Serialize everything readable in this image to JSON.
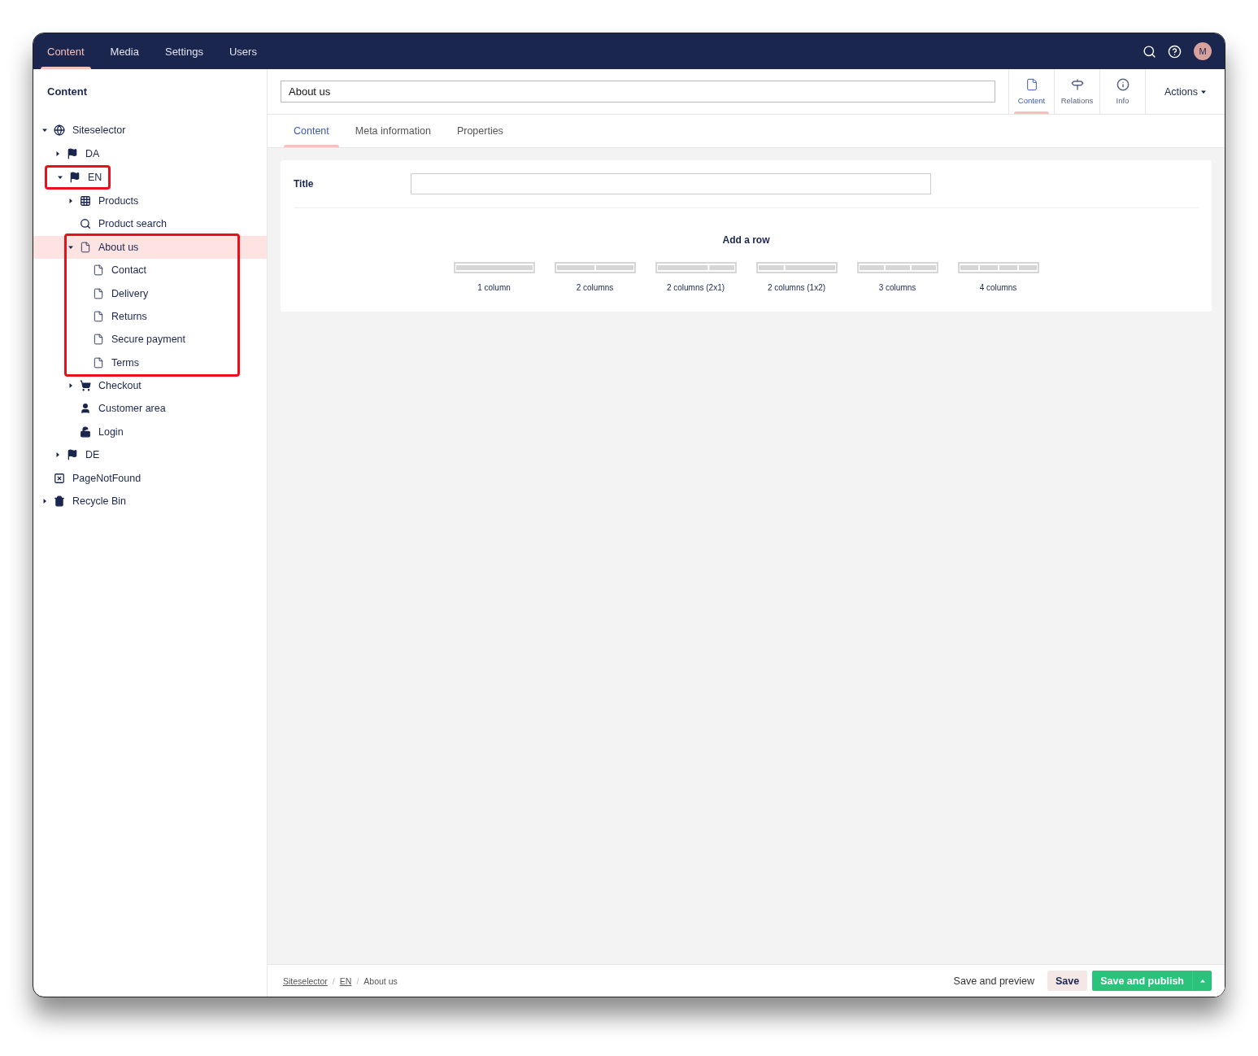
{
  "top_nav": {
    "sections": [
      {
        "label": "Content",
        "selected": true
      },
      {
        "label": "Media",
        "selected": false
      },
      {
        "label": "Settings",
        "selected": false
      },
      {
        "label": "Users",
        "selected": false
      }
    ],
    "avatar": "M"
  },
  "sidebar": {
    "title": "Content",
    "tree": [
      {
        "label": "Siteselector",
        "kind": "globe",
        "expanded": true,
        "selected": false,
        "children": [
          {
            "label": "DA",
            "kind": "flag",
            "expanded": false,
            "selected": false
          },
          {
            "label": "EN",
            "kind": "flag",
            "expanded": true,
            "selected": false,
            "outlined": true,
            "outline_children": false,
            "children": [
              {
                "label": "Products",
                "kind": "grid",
                "expanded": false,
                "selected": false
              },
              {
                "label": "Product search",
                "kind": "search",
                "selected": false
              },
              {
                "label": "About us",
                "kind": "doc",
                "expanded": true,
                "selected": true,
                "outlined": true,
                "outline_children": true,
                "children": [
                  {
                    "label": "Contact",
                    "kind": "doc",
                    "selected": false
                  },
                  {
                    "label": "Delivery",
                    "kind": "doc",
                    "selected": false
                  },
                  {
                    "label": "Returns",
                    "kind": "doc",
                    "selected": false
                  },
                  {
                    "label": "Secure payment",
                    "kind": "doc",
                    "selected": false
                  },
                  {
                    "label": "Terms",
                    "kind": "doc",
                    "selected": false
                  }
                ]
              },
              {
                "label": "Checkout",
                "kind": "cart",
                "expanded": false,
                "selected": false
              },
              {
                "label": "Customer area",
                "kind": "user",
                "selected": false
              },
              {
                "label": "Login",
                "kind": "unlock",
                "selected": false
              }
            ]
          },
          {
            "label": "DE",
            "kind": "flag",
            "expanded": false,
            "selected": false
          }
        ]
      },
      {
        "label": "PageNotFound",
        "kind": "notfound",
        "selected": false
      },
      {
        "label": "Recycle Bin",
        "kind": "trash",
        "expanded": false,
        "selected": false
      }
    ]
  },
  "editor": {
    "name": "About us",
    "apps": [
      {
        "label": "Content",
        "kind": "doc",
        "selected": true
      },
      {
        "label": "Relations",
        "kind": "signpost",
        "selected": false
      },
      {
        "label": "Info",
        "kind": "info",
        "selected": false
      }
    ],
    "actions": "Actions",
    "tabs": [
      {
        "label": "Content",
        "selected": true
      },
      {
        "label": "Meta information",
        "selected": false
      },
      {
        "label": "Properties",
        "selected": false
      }
    ],
    "fields": [
      {
        "label": "Title"
      }
    ],
    "add_row": {
      "title": "Add a row",
      "layouts": [
        {
          "label": "1 column",
          "kind": "one"
        },
        {
          "label": "2 columns",
          "kind": "two"
        },
        {
          "label": "2 columns (2x1)",
          "kind": "wideleft"
        },
        {
          "label": "2 columns (1x2)",
          "kind": "wideright"
        },
        {
          "label": "3 columns",
          "kind": "three"
        },
        {
          "label": "4 columns",
          "kind": "four"
        }
      ]
    }
  },
  "footer": {
    "breadcrumbs": [
      {
        "label": "Siteselector",
        "link": true
      },
      {
        "label": "EN",
        "link": true
      },
      {
        "label": "About us",
        "link": false
      }
    ],
    "separators": [
      "/",
      "/"
    ],
    "save_preview": "Save and preview",
    "save": "Save",
    "publish": "Save and publish"
  }
}
